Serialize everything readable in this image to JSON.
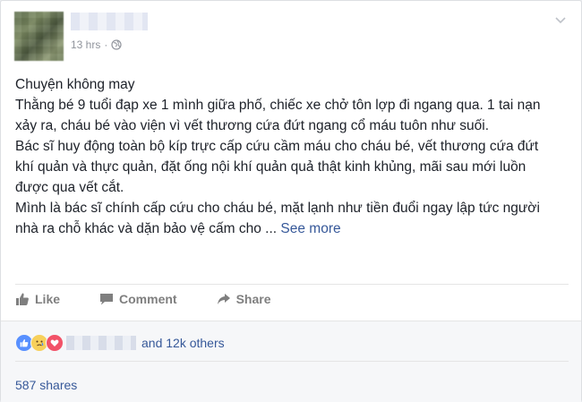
{
  "post": {
    "timestamp": "13 hrs",
    "separator": "·",
    "paragraphs": [
      "Chuyện không may",
      "Thằng bé 9 tuổi đạp xe 1 mình giữa phố, chiếc xe chở tôn lợp đi ngang qua. 1 tai nạn xảy ra, cháu bé vào viện vì vết thương cứa đứt ngang cổ máu tuôn như suối.",
      "Bác sĩ huy động toàn bộ kíp trực cấp cứu cầm máu cho cháu bé, vết thương cứa đứt khí quản và thực quản, đặt ống nội khí quản quả thật kinh khủng, mãi sau mới luồn được qua vết cắt.",
      "Mình là bác sĩ chính cấp cứu cho cháu bé, mặt lạnh như tiền đuổi ngay lập tức người nhà ra chỗ khác và dặn bảo vệ cấm cho ..."
    ],
    "see_more": "See more"
  },
  "actions": {
    "like": "Like",
    "comment": "Comment",
    "share": "Share"
  },
  "reactions": {
    "icons": [
      "like-reaction-icon",
      "sad-reaction-icon",
      "love-reaction-icon"
    ],
    "others_text": "and 12k others"
  },
  "shares": "587 shares",
  "colors": {
    "link": "#365899",
    "meta": "#90949c",
    "action": "#7f7f7f",
    "like": "#5890ff",
    "love": "#f25268",
    "sad": "#f7d05b"
  }
}
